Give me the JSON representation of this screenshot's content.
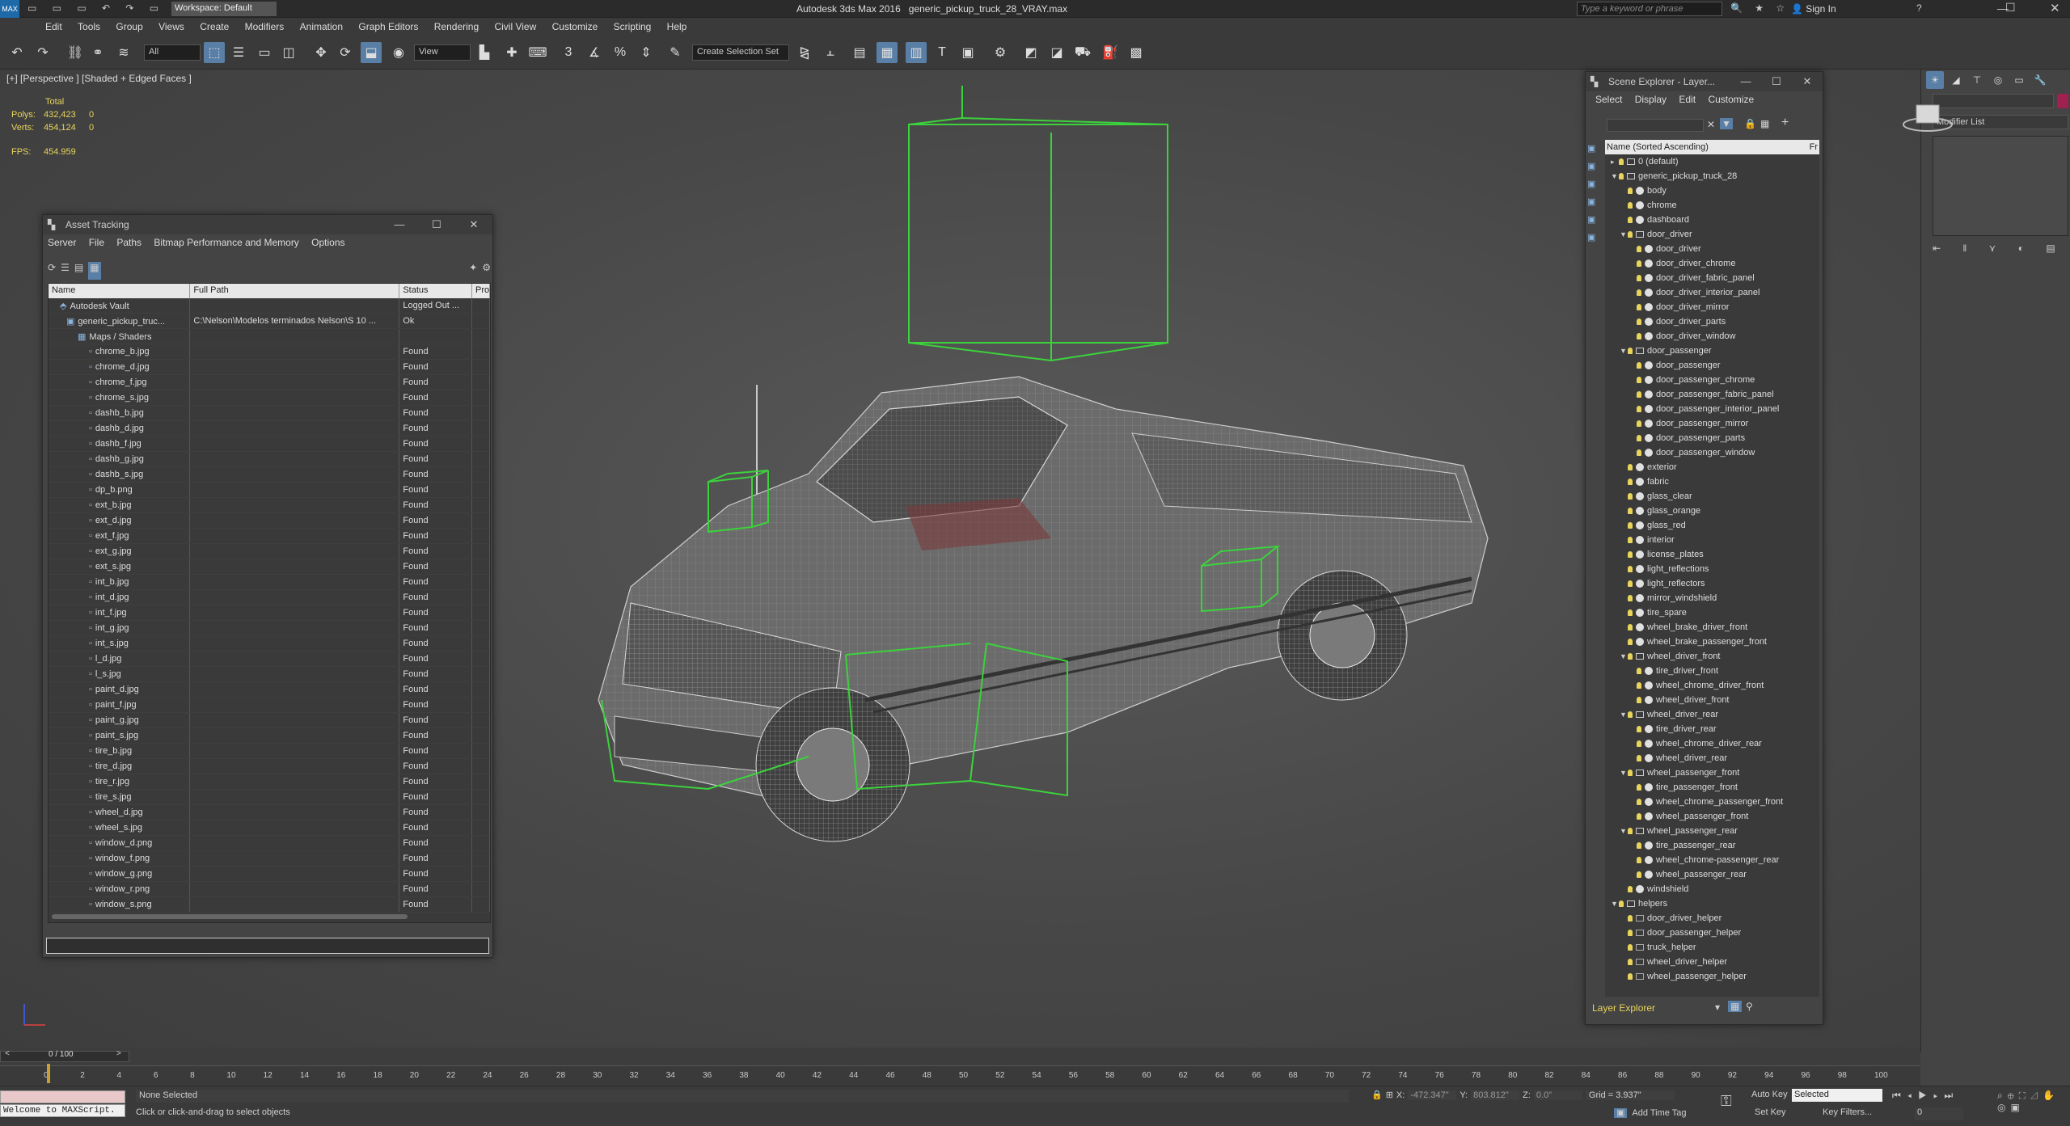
{
  "app": {
    "title": "Autodesk 3ds Max 2016",
    "file": "generic_pickup_truck_28_VRAY.max",
    "workspace": "Workspace: Default",
    "search_placeholder": "Type a keyword or phrase",
    "signin": "Sign In"
  },
  "menu": [
    "Edit",
    "Tools",
    "Group",
    "Views",
    "Create",
    "Modifiers",
    "Animation",
    "Graph Editors",
    "Rendering",
    "Civil View",
    "Customize",
    "Scripting",
    "Help"
  ],
  "toolbar": {
    "filter": "All",
    "ref_coord": "View",
    "selection_set": "Create Selection Set"
  },
  "viewport": {
    "label": "[+] [Perspective ] [Shaded + Edged Faces ]",
    "stats_total": "Total",
    "polys_label": "Polys:",
    "polys_value": "432,423",
    "polys_sel": "0",
    "verts_label": "Verts:",
    "verts_value": "454,124",
    "verts_sel": "0",
    "fps_label": "FPS:",
    "fps_value": "454.959"
  },
  "asset": {
    "title": "Asset Tracking",
    "menu": [
      "Server",
      "File",
      "Paths",
      "Bitmap Performance and Memory",
      "Options"
    ],
    "columns": [
      "Name",
      "Full Path",
      "Status",
      "Pro"
    ],
    "rows": [
      {
        "name": "Autodesk Vault",
        "path": "",
        "status": "Logged Out ..."
      },
      {
        "name": "generic_pickup_truc...",
        "path": "C:\\Nelson\\Modelos terminados Nelson\\S 10 ...",
        "status": "Ok"
      },
      {
        "name": "Maps / Shaders",
        "path": "",
        "status": ""
      },
      {
        "name": "chrome_b.jpg",
        "path": "",
        "status": "Found"
      },
      {
        "name": "chrome_d.jpg",
        "path": "",
        "status": "Found"
      },
      {
        "name": "chrome_f.jpg",
        "path": "",
        "status": "Found"
      },
      {
        "name": "chrome_s.jpg",
        "path": "",
        "status": "Found"
      },
      {
        "name": "dashb_b.jpg",
        "path": "",
        "status": "Found"
      },
      {
        "name": "dashb_d.jpg",
        "path": "",
        "status": "Found"
      },
      {
        "name": "dashb_f.jpg",
        "path": "",
        "status": "Found"
      },
      {
        "name": "dashb_g.jpg",
        "path": "",
        "status": "Found"
      },
      {
        "name": "dashb_s.jpg",
        "path": "",
        "status": "Found"
      },
      {
        "name": "dp_b.png",
        "path": "",
        "status": "Found"
      },
      {
        "name": "ext_b.jpg",
        "path": "",
        "status": "Found"
      },
      {
        "name": "ext_d.jpg",
        "path": "",
        "status": "Found"
      },
      {
        "name": "ext_f.jpg",
        "path": "",
        "status": "Found"
      },
      {
        "name": "ext_g.jpg",
        "path": "",
        "status": "Found"
      },
      {
        "name": "ext_s.jpg",
        "path": "",
        "status": "Found"
      },
      {
        "name": "int_b.jpg",
        "path": "",
        "status": "Found"
      },
      {
        "name": "int_d.jpg",
        "path": "",
        "status": "Found"
      },
      {
        "name": "int_f.jpg",
        "path": "",
        "status": "Found"
      },
      {
        "name": "int_g.jpg",
        "path": "",
        "status": "Found"
      },
      {
        "name": "int_s.jpg",
        "path": "",
        "status": "Found"
      },
      {
        "name": "l_d.jpg",
        "path": "",
        "status": "Found"
      },
      {
        "name": "l_s.jpg",
        "path": "",
        "status": "Found"
      },
      {
        "name": "paint_d.jpg",
        "path": "",
        "status": "Found"
      },
      {
        "name": "paint_f.jpg",
        "path": "",
        "status": "Found"
      },
      {
        "name": "paint_g.jpg",
        "path": "",
        "status": "Found"
      },
      {
        "name": "paint_s.jpg",
        "path": "",
        "status": "Found"
      },
      {
        "name": "tire_b.jpg",
        "path": "",
        "status": "Found"
      },
      {
        "name": "tire_d.jpg",
        "path": "",
        "status": "Found"
      },
      {
        "name": "tire_r.jpg",
        "path": "",
        "status": "Found"
      },
      {
        "name": "tire_s.jpg",
        "path": "",
        "status": "Found"
      },
      {
        "name": "wheel_d.jpg",
        "path": "",
        "status": "Found"
      },
      {
        "name": "wheel_s.jpg",
        "path": "",
        "status": "Found"
      },
      {
        "name": "window_d.png",
        "path": "",
        "status": "Found"
      },
      {
        "name": "window_f.png",
        "path": "",
        "status": "Found"
      },
      {
        "name": "window_g.png",
        "path": "",
        "status": "Found"
      },
      {
        "name": "window_r.png",
        "path": "",
        "status": "Found"
      },
      {
        "name": "window_s.png",
        "path": "",
        "status": "Found"
      }
    ]
  },
  "scene": {
    "title": "Scene Explorer - Layer...",
    "menu": [
      "Select",
      "Display",
      "Edit",
      "Customize"
    ],
    "header": "Name (Sorted Ascending)",
    "header2": "Fr",
    "footer": "Layer Explorer",
    "items": [
      {
        "d": 1,
        "t": "lay",
        "label": "0 (default)"
      },
      {
        "d": 1,
        "t": "lay",
        "label": "generic_pickup_truck_28",
        "open": true
      },
      {
        "d": 2,
        "t": "obj",
        "label": "body"
      },
      {
        "d": 2,
        "t": "obj",
        "label": "chrome"
      },
      {
        "d": 2,
        "t": "obj",
        "label": "dashboard"
      },
      {
        "d": 2,
        "t": "lay",
        "label": "door_driver",
        "open": true
      },
      {
        "d": 3,
        "t": "obj",
        "label": "door_driver"
      },
      {
        "d": 3,
        "t": "obj",
        "label": "door_driver_chrome"
      },
      {
        "d": 3,
        "t": "obj",
        "label": "door_driver_fabric_panel"
      },
      {
        "d": 3,
        "t": "obj",
        "label": "door_driver_interior_panel"
      },
      {
        "d": 3,
        "t": "obj",
        "label": "door_driver_mirror"
      },
      {
        "d": 3,
        "t": "obj",
        "label": "door_driver_parts"
      },
      {
        "d": 3,
        "t": "obj",
        "label": "door_driver_window"
      },
      {
        "d": 2,
        "t": "lay",
        "label": "door_passenger",
        "open": true
      },
      {
        "d": 3,
        "t": "obj",
        "label": "door_passenger"
      },
      {
        "d": 3,
        "t": "obj",
        "label": "door_passenger_chrome"
      },
      {
        "d": 3,
        "t": "obj",
        "label": "door_passenger_fabric_panel"
      },
      {
        "d": 3,
        "t": "obj",
        "label": "door_passenger_interior_panel"
      },
      {
        "d": 3,
        "t": "obj",
        "label": "door_passenger_mirror"
      },
      {
        "d": 3,
        "t": "obj",
        "label": "door_passenger_parts"
      },
      {
        "d": 3,
        "t": "obj",
        "label": "door_passenger_window"
      },
      {
        "d": 2,
        "t": "obj",
        "label": "exterior"
      },
      {
        "d": 2,
        "t": "obj",
        "label": "fabric"
      },
      {
        "d": 2,
        "t": "obj",
        "label": "glass_clear"
      },
      {
        "d": 2,
        "t": "obj",
        "label": "glass_orange"
      },
      {
        "d": 2,
        "t": "obj",
        "label": "glass_red"
      },
      {
        "d": 2,
        "t": "obj",
        "label": "interior"
      },
      {
        "d": 2,
        "t": "obj",
        "label": "license_plates"
      },
      {
        "d": 2,
        "t": "obj",
        "label": "light_reflections"
      },
      {
        "d": 2,
        "t": "obj",
        "label": "light_reflectors"
      },
      {
        "d": 2,
        "t": "obj",
        "label": "mirror_windshield"
      },
      {
        "d": 2,
        "t": "obj",
        "label": "tire_spare"
      },
      {
        "d": 2,
        "t": "obj",
        "label": "wheel_brake_driver_front"
      },
      {
        "d": 2,
        "t": "obj",
        "label": "wheel_brake_passenger_front"
      },
      {
        "d": 2,
        "t": "lay",
        "label": "wheel_driver_front",
        "open": true
      },
      {
        "d": 3,
        "t": "obj",
        "label": "tire_driver_front"
      },
      {
        "d": 3,
        "t": "obj",
        "label": "wheel_chrome_driver_front"
      },
      {
        "d": 3,
        "t": "obj",
        "label": "wheel_driver_front"
      },
      {
        "d": 2,
        "t": "lay",
        "label": "wheel_driver_rear",
        "open": true
      },
      {
        "d": 3,
        "t": "obj",
        "label": "tire_driver_rear"
      },
      {
        "d": 3,
        "t": "obj",
        "label": "wheel_chrome_driver_rear"
      },
      {
        "d": 3,
        "t": "obj",
        "label": "wheel_driver_rear"
      },
      {
        "d": 2,
        "t": "lay",
        "label": "wheel_passenger_front",
        "open": true
      },
      {
        "d": 3,
        "t": "obj",
        "label": "tire_passenger_front"
      },
      {
        "d": 3,
        "t": "obj",
        "label": "wheel_chrome_passenger_front"
      },
      {
        "d": 3,
        "t": "obj",
        "label": "wheel_passenger_front"
      },
      {
        "d": 2,
        "t": "lay",
        "label": "wheel_passenger_rear",
        "open": true
      },
      {
        "d": 3,
        "t": "obj",
        "label": "tire_passenger_rear"
      },
      {
        "d": 3,
        "t": "obj",
        "label": "wheel_chrome-passenger_rear"
      },
      {
        "d": 3,
        "t": "obj",
        "label": "wheel_passenger_rear"
      },
      {
        "d": 2,
        "t": "obj",
        "label": "windshield"
      },
      {
        "d": 1,
        "t": "lay",
        "label": "helpers",
        "open": true
      },
      {
        "d": 2,
        "t": "hlp",
        "label": "door_driver_helper"
      },
      {
        "d": 2,
        "t": "hlp",
        "label": "door_passenger_helper"
      },
      {
        "d": 2,
        "t": "hlp",
        "label": "truck_helper"
      },
      {
        "d": 2,
        "t": "hlp",
        "label": "wheel_driver_helper"
      },
      {
        "d": 2,
        "t": "hlp",
        "label": "wheel_passenger_helper"
      }
    ]
  },
  "cmdpanel": {
    "modifier_list": "Modifier List"
  },
  "timeline": {
    "frame": "0 / 100",
    "ticks": [
      "0",
      "2",
      "4",
      "6",
      "8",
      "10",
      "12",
      "14",
      "16",
      "18",
      "20",
      "22",
      "24",
      "26",
      "28",
      "30",
      "32",
      "34",
      "36",
      "38",
      "40",
      "42",
      "44",
      "46",
      "48",
      "50",
      "52",
      "54",
      "56",
      "58",
      "60",
      "62",
      "64",
      "66",
      "68",
      "70",
      "72",
      "74",
      "76",
      "78",
      "80",
      "82",
      "84",
      "86",
      "88",
      "90",
      "92",
      "94",
      "96",
      "98",
      "100"
    ]
  },
  "status": {
    "maxscript": "Welcome to MAXScript.",
    "selected": "None Selected",
    "prompt": "Click or click-and-drag to select objects",
    "x_label": "X:",
    "x": "-472.347\"",
    "y_label": "Y:",
    "y": "803.812\"",
    "z_label": "Z:",
    "z": "0.0\"",
    "grid": "Grid = 3.937\"",
    "autokey": "Auto Key",
    "autokey_sel": "Selected",
    "setkey": "Set Key",
    "keyfilters": "Key Filters...",
    "addtimetag": "Add Time Tag",
    "frame_field": "0"
  },
  "colors": {
    "accent": "#5a7fa6",
    "helper_box": "#3cd23c",
    "stats": "#e8d45a"
  }
}
